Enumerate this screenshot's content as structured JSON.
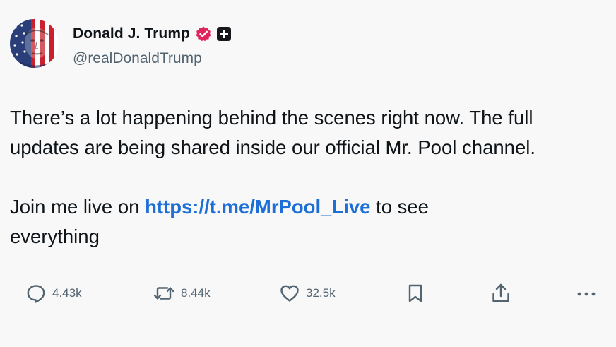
{
  "profile": {
    "display_name": "Donald J. Trump",
    "handle": "@realDonaldTrump",
    "avatar_icon": "flag-face-avatar",
    "verified_icon": "verified-badge-icon",
    "verified_color": "#e0245e",
    "affiliation_icon": "affiliation-badge-icon"
  },
  "post": {
    "line1": "There’s a lot happening behind the scenes right now. The full",
    "line2": "updates are being shared inside our official Mr. Pool channel.",
    "para2_prefix": "Join me live on ",
    "link_text": "https://t.me/MrPool_Live",
    "para2_suffix": " to see",
    "para2_line2": "everything"
  },
  "actions": {
    "replies": "4.43k",
    "reposts": "8.44k",
    "likes": "32.5k"
  },
  "colors": {
    "link": "#1d6fd6",
    "text": "#0f1419",
    "muted": "#536471"
  }
}
